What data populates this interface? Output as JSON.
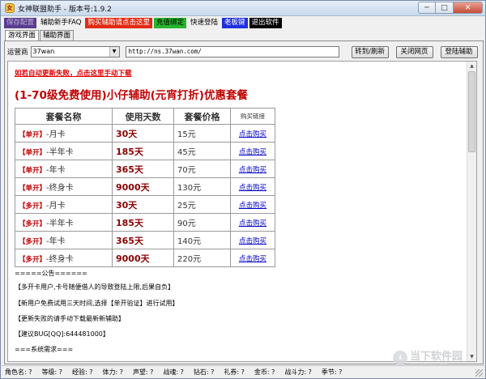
{
  "window": {
    "title": "女神联盟助手 - 版本号:1.9.2",
    "icon_glyph": "女",
    "controls": {
      "minimize": "─",
      "maximize": "□",
      "close": "✕"
    }
  },
  "menu": {
    "items": [
      {
        "label": "保存配置",
        "bg": "#5a3d91",
        "color": "#b9b0d6"
      },
      {
        "label": "辅助新手FAQ",
        "bg": "",
        "color": "#000000"
      },
      {
        "label": "购买辅助请点击这里",
        "bg": "#e42a12",
        "color": "#ffffff"
      },
      {
        "label": "充值绑定",
        "bg": "#27b52d",
        "color": "#000000"
      },
      {
        "label": "快速登陆",
        "bg": "",
        "color": "#000000"
      },
      {
        "label": "老板键",
        "bg": "#1f2fe0",
        "color": "#ffffff"
      },
      {
        "label": "退出软件",
        "bg": "#000000",
        "color": "#ffffff"
      }
    ]
  },
  "tabs": [
    "游戏界面",
    "辅助界面"
  ],
  "toolbar": {
    "operator_label": "运营商",
    "operator_value": "37wan",
    "url": "http://ns.37wan.com/",
    "buttons": [
      "转到/刷新",
      "关闭网页",
      "登陆辅助"
    ]
  },
  "page": {
    "warning": "如若自动更新失败，点击这里手动下载",
    "heading": "(1-70级免费使用)小仔辅助(元宵打折)优惠套餐",
    "table": {
      "headers": [
        "套餐名称",
        "使用天数",
        "套餐价格",
        "购买链接"
      ],
      "rows": [
        {
          "tag": "【单开】",
          "name": "-月卡",
          "days": "30天",
          "price": "15元",
          "link": "点击购买"
        },
        {
          "tag": "【单开】",
          "name": "-半年卡",
          "days": "185天",
          "price": "45元",
          "link": "点击购买"
        },
        {
          "tag": "【单开】",
          "name": "-年卡",
          "days": "365天",
          "price": "70元",
          "link": "点击购买"
        },
        {
          "tag": "【单开】",
          "name": "-终身卡",
          "days": "9000天",
          "price": "130元",
          "link": "点击购买"
        },
        {
          "tag": "【多开】",
          "name": "-月卡",
          "days": "30天",
          "price": "25元",
          "link": "点击购买"
        },
        {
          "tag": "【多开】",
          "name": "-半年卡",
          "days": "185天",
          "price": "90元",
          "link": "点击购买"
        },
        {
          "tag": "【多开】",
          "name": "-年卡",
          "days": "365天",
          "price": "140元",
          "link": "点击购买"
        },
        {
          "tag": "【多开】",
          "name": "-终身卡",
          "days": "9000天",
          "price": "220元",
          "link": "点击购买"
        }
      ]
    },
    "notes": [
      "=====公告======",
      "【多开卡用户,卡号随便借人的导致登陆上限,后果自负】",
      "【新用户免费试用三天时间,选择【单开验证】进行试用】",
      "【更新失败的请手动下载最新新辅助】",
      "【建议BUG[QQ]:644481000】",
      "===系统需求==="
    ]
  },
  "watermark": {
    "text": "当下软件园",
    "sub": "www.downxia.com",
    "glyph": "↓"
  },
  "status_bar": [
    "角色名: ?",
    "等级: ?",
    "经验: ?",
    "体力: ?",
    "声望: ?",
    "战魂: ?",
    "钻石: ?",
    "礼券: ?",
    "金币: ?",
    "战斗力: ?",
    "季节: ?"
  ]
}
